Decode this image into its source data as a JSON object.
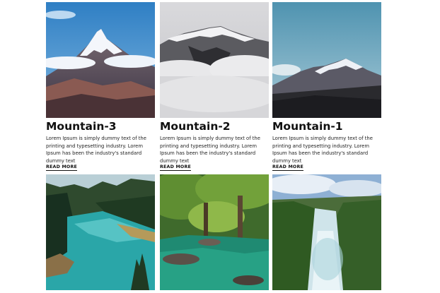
{
  "cards": [
    {
      "title": "Mountain-3",
      "description": "Lorem Ipsum is simply dummy text of the printing and typesetting industry. Lorem Ipsum has been the industry's standard dummy text",
      "link_label": "READ MORE",
      "image": "snowy mountain peak under blue sky"
    },
    {
      "title": "Mountain-2",
      "description": "Lorem Ipsum is simply dummy text of the printing and typesetting industry. Lorem Ipsum has been the industry's standard dummy text",
      "link_label": "READ MORE",
      "image": "misty grey mountain range above clouds"
    },
    {
      "title": "Mountain-1",
      "description": "Lorem Ipsum is simply dummy text of the printing and typesetting industry. Lorem Ipsum has been the industry's standard dummy text",
      "link_label": "READ MORE",
      "image": "mountain ridge with dark foreground"
    }
  ],
  "bottom_images": [
    {
      "image": "turquoise river through pine forest"
    },
    {
      "image": "green forest stream with rocks"
    },
    {
      "image": "rushing white-water river between trees"
    }
  ]
}
